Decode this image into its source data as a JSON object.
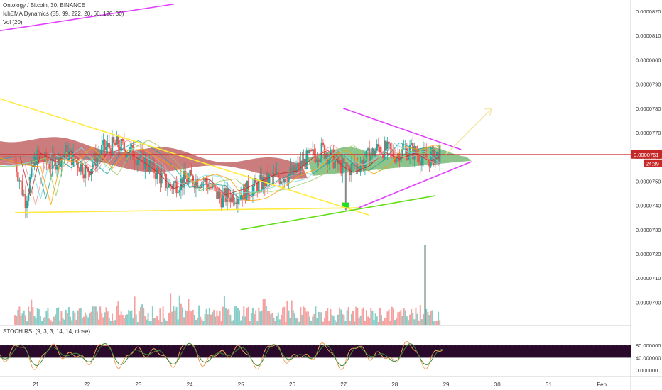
{
  "legend": {
    "symbol_line": "Ontology / Bitcoin, 30, BINANCE",
    "indicator_line": "IchEMA Dynamics (55, 99, 222, 20, 60, 120, 30)",
    "volume_line": "Vol (20)",
    "stoch_line": "STOCH ṚSI (9, 3, 3, 14, 14, close)"
  },
  "price_axis": {
    "ticks": [
      "0.0000820",
      "0.0000810",
      "0.0000800",
      "0.0000790",
      "0.0000780",
      "0.0000770",
      "0.0000760",
      "0.0000750",
      "0.0000740",
      "0.0000730",
      "0.0000720",
      "0.0000710",
      "0.0000700"
    ]
  },
  "badges": {
    "last_price": "0.0000761",
    "countdown": "24:39"
  },
  "stoch_axis": {
    "ticks": [
      "80.000000",
      "40.000000",
      "0.000000"
    ]
  },
  "time_axis": {
    "ticks": [
      "21",
      "22",
      "23",
      "24",
      "25",
      "26",
      "27",
      "28",
      "29",
      "30",
      "31",
      "Feb"
    ]
  },
  "colors": {
    "up": "#26a69a",
    "down": "#ef5350",
    "price_line": "#c62828",
    "magenta": "#e040fb",
    "yellow": "#ffeb3b",
    "green": "#64dd17",
    "projection": "#f5e6a8",
    "stoch_k": "#f0a058",
    "stoch_d": "#3a8a3a",
    "stoch_band": "#2a0a2a",
    "cloud_red": "#a01010",
    "cloud_green": "#1a8a1a"
  },
  "chart_data": {
    "type": "candlestick",
    "title": "Ontology / Bitcoin, 30, BINANCE",
    "x_ticks": [
      "21",
      "22",
      "23",
      "24",
      "25",
      "26",
      "27",
      "28",
      "29",
      "30",
      "31",
      "Feb"
    ],
    "ylim": [
      6.95e-05,
      8.25e-05
    ],
    "last_price": 7.61e-05,
    "price_path": [
      {
        "day": 20.6,
        "price": 7.58e-05
      },
      {
        "day": 20.8,
        "price": 7.42e-05
      },
      {
        "day": 21.0,
        "price": 7.6e-05
      },
      {
        "day": 21.3,
        "price": 7.57e-05
      },
      {
        "day": 21.6,
        "price": 7.62e-05
      },
      {
        "day": 22.0,
        "price": 7.54e-05
      },
      {
        "day": 22.3,
        "price": 7.63e-05
      },
      {
        "day": 22.6,
        "price": 7.65e-05
      },
      {
        "day": 23.0,
        "price": 7.6e-05
      },
      {
        "day": 23.3,
        "price": 7.55e-05
      },
      {
        "day": 23.6,
        "price": 7.48e-05
      },
      {
        "day": 24.0,
        "price": 7.51e-05
      },
      {
        "day": 24.3,
        "price": 7.5e-05
      },
      {
        "day": 24.6,
        "price": 7.43e-05
      },
      {
        "day": 25.0,
        "price": 7.45e-05
      },
      {
        "day": 25.3,
        "price": 7.48e-05
      },
      {
        "day": 25.6,
        "price": 7.51e-05
      },
      {
        "day": 26.0,
        "price": 7.53e-05
      },
      {
        "day": 26.3,
        "price": 7.59e-05
      },
      {
        "day": 26.6,
        "price": 7.63e-05
      },
      {
        "day": 26.9,
        "price": 7.57e-05
      },
      {
        "day": 27.1,
        "price": 7.55e-05
      },
      {
        "day": 27.4,
        "price": 7.58e-05
      },
      {
        "day": 27.7,
        "price": 7.64e-05
      },
      {
        "day": 28.0,
        "price": 7.61e-05
      },
      {
        "day": 28.3,
        "price": 7.63e-05
      },
      {
        "day": 28.6,
        "price": 7.59e-05
      },
      {
        "day": 28.9,
        "price": 7.61e-05
      }
    ],
    "lines": [
      {
        "name": "downtrend",
        "color": "yellow",
        "points": [
          [
            20.0,
            7.86e-05
          ],
          [
            27.5,
            7.36e-05
          ]
        ]
      },
      {
        "name": "support",
        "color": "yellow",
        "points": [
          [
            20.6,
            7.37e-05
          ],
          [
            27.3,
            7.39e-05
          ]
        ]
      },
      {
        "name": "wedge_top",
        "color": "magenta",
        "points": [
          [
            27.0,
            7.8e-05
          ],
          [
            29.3,
            7.63e-05
          ]
        ]
      },
      {
        "name": "wedge_bottom",
        "color": "magenta",
        "points": [
          [
            27.3,
            7.39e-05
          ],
          [
            29.5,
            7.58e-05
          ]
        ]
      },
      {
        "name": "rising_support",
        "color": "green",
        "points": [
          [
            25.0,
            7.3e-05
          ],
          [
            28.8,
            7.44e-05
          ]
        ]
      },
      {
        "name": "top_trend",
        "color": "magenta",
        "points": [
          [
            20.0,
            8.11e-05
          ],
          [
            23.7,
            8.23e-05
          ]
        ]
      }
    ],
    "projection": {
      "from": [
        29.0,
        7.61e-05
      ],
      "to": [
        29.9,
        7.8e-05
      ]
    },
    "volume_spike": {
      "day": 28.6,
      "label": "spike"
    },
    "stochastic": {
      "levels": [
        80,
        40,
        0
      ],
      "period": "9,3,3,14,14"
    }
  }
}
